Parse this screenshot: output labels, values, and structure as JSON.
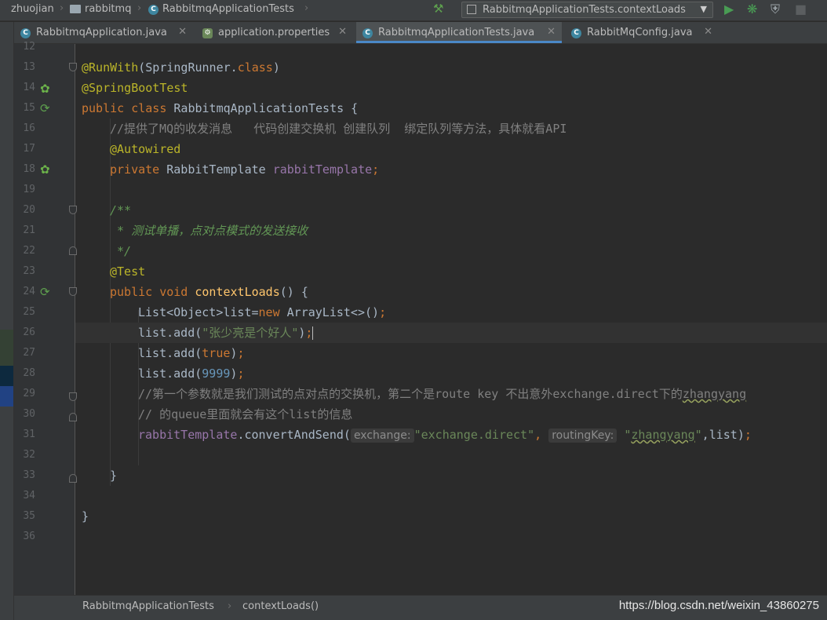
{
  "breadcrumb": {
    "project": "zhuojian",
    "module": "rabbitmq",
    "file": "RabbitmqApplicationTests"
  },
  "toolbar": {
    "run_config": "RabbitmqApplicationTests.contextLoads"
  },
  "tabs": [
    {
      "label": "RabbitmqApplication.java",
      "icon": "class-icon"
    },
    {
      "label": "application.properties",
      "icon": "properties-icon"
    },
    {
      "label": "RabbitmqApplicationTests.java",
      "icon": "class-icon",
      "active": true
    },
    {
      "label": "RabbitMqConfig.java",
      "icon": "class-icon"
    }
  ],
  "line_numbers": [
    "12",
    "13",
    "14",
    "15",
    "16",
    "17",
    "18",
    "19",
    "20",
    "21",
    "22",
    "23",
    "24",
    "25",
    "26",
    "27",
    "28",
    "29",
    "30",
    "31",
    "32",
    "33",
    "34",
    "35",
    "36"
  ],
  "code": {
    "l13_annot": "@RunWith",
    "l13_open": "(SpringRunner.",
    "l13_kw": "class",
    "l13_close": ")",
    "l14_annot": "@SpringBootTest",
    "l15_public": "public",
    "l15_class": "class",
    "l15_name": "RabbitmqApplicationTests {",
    "l16_comment": "//提供了MQ的收发消息   代码创建交换机 创建队列  绑定队列等方法，具体就看API",
    "l17_annot": "@Autowired",
    "l18_private": "private",
    "l18_type": "RabbitTemplate",
    "l18_field": "rabbitTemplate",
    "l18_semi": ";",
    "l20_doc": "/**",
    "l21_doc": " * 测试单播，点对点模式的发送接收",
    "l22_doc": " */",
    "l23_annot": "@Test",
    "l24_public": "public",
    "l24_void": "void",
    "l24_method": "contextLoads",
    "l24_rest": "() {",
    "l25_a": "List<Object>list=",
    "l25_new": "new",
    "l25_b": "ArrayList<>()",
    "l25_semi": ";",
    "l26_a": "list.add(",
    "l26_str": "\"张少亮是个好人\"",
    "l26_b": ")",
    "l26_semi": ";",
    "l27_a": "list.add(",
    "l27_val": "true",
    "l27_b": ")",
    "l27_semi": ";",
    "l28_a": "list.add(",
    "l28_val": "9999",
    "l28_b": ")",
    "l28_semi": ";",
    "l29_comment": "//第一个参数就是我们测试的点对点的交换机，第二个是route key 不出意外exchange.direct下的",
    "l29_squig": "zhangyang",
    "l30_comment": "// 的queue里面就会有这个list的信息",
    "l31_field": "rabbitTemplate",
    "l31_call": ".convertAndSend(",
    "l31_hint1": "exchange:",
    "l31_str1": "\"exchange.direct\"",
    "l31_comma1": ",",
    "l31_hint2": "routingKey:",
    "l31_str2a": "\"",
    "l31_str2b": "zhangyang",
    "l31_str2c": "\"",
    "l31_rest": ",list)",
    "l31_semi": ";",
    "l33_brace": "}",
    "l35_brace": "}"
  },
  "status": {
    "breadcrumb_class": "RabbitmqApplicationTests",
    "breadcrumb_method": "contextLoads()",
    "watermark": "https://blog.csdn.net/weixin_43860275"
  },
  "colors": {
    "background": "#2b2b2b",
    "keyword": "#cc7832",
    "annotation": "#bbb529",
    "field": "#9876aa",
    "string": "#6a8759",
    "number": "#6897bb",
    "comment": "#808080",
    "method": "#ffc66d"
  }
}
